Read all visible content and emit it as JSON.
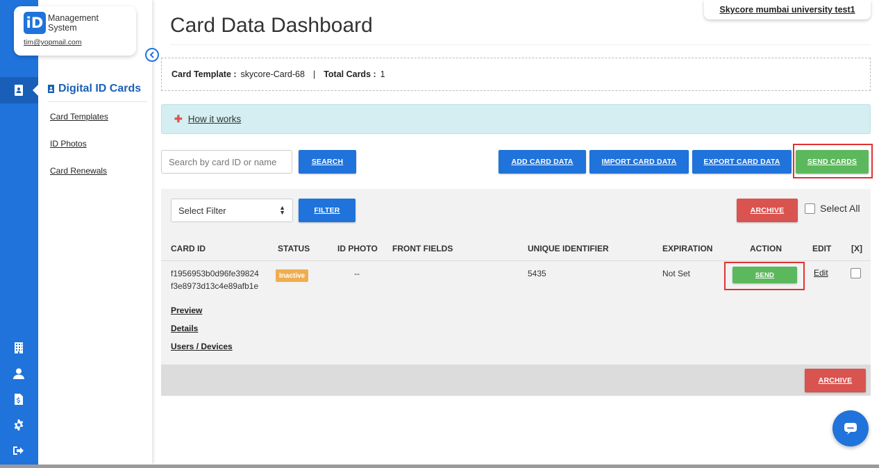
{
  "brand": {
    "logo_mark": "iD",
    "name_line1": "Management",
    "name_line2": "System",
    "email": "tim@yopmail.com"
  },
  "rail": {
    "active_icon": "id-card-icon",
    "icons": [
      "building-icon",
      "user-icon",
      "invoice-icon",
      "gear-icon",
      "sign-out-icon"
    ]
  },
  "submenu": {
    "title": "Digital ID Cards",
    "items": [
      {
        "label": "Card Templates"
      },
      {
        "label": "ID Photos"
      },
      {
        "label": "Card Renewals"
      }
    ]
  },
  "header": {
    "title": "Card Data Dashboard",
    "university": "Skycore mumbai university test1"
  },
  "template_info": {
    "template_label": "Card Template :",
    "template_value": "skycore-Card-68",
    "separator": "|",
    "total_label": "Total Cards :",
    "total_value": "1"
  },
  "how_it_works": {
    "label": "How it works",
    "icon": "plus-icon"
  },
  "search": {
    "placeholder": "Search by card ID or name",
    "button": "SEARCH"
  },
  "actions": {
    "add": "ADD CARD DATA",
    "import": "IMPORT CARD DATA",
    "export": "EXPORT CARD DATA",
    "send": "SEND CARDS"
  },
  "filter": {
    "select_value": "Select Filter",
    "button": "FILTER",
    "archive": "ARCHIVE",
    "select_all": "Select All"
  },
  "table": {
    "columns": [
      "CARD ID",
      "STATUS",
      "ID PHOTO",
      "FRONT FIELDS",
      "UNIQUE IDENTIFIER",
      "EXPIRATION",
      "ACTION",
      "EDIT",
      "[X]"
    ],
    "rows": [
      {
        "card_id": "f1956953b0d96fe39824f3e8973d13c4e89afb1e",
        "status": "Inactive",
        "id_photo": "--",
        "front_fields": "",
        "unique_identifier": "5435",
        "expiration": "Not Set",
        "action": "SEND",
        "edit": "Edit",
        "links": [
          "Preview",
          "Details",
          "Users / Devices"
        ]
      }
    ],
    "footer_archive": "ARCHIVE"
  },
  "colors": {
    "primary": "#1f73db",
    "success": "#5cb85c",
    "danger": "#d9534f",
    "warning": "#f0ad4e",
    "info_bg": "#d4eef1",
    "highlight": "#e03131"
  }
}
